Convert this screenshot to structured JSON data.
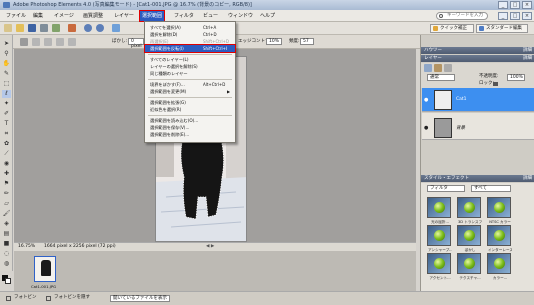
{
  "titlebar": {
    "title": "Adobe Photoshop Elements 4.0 (写真編集モード) - [Cat1-001.JPG @ 16.7% (背景のコピー, RGB/8)]"
  },
  "menubar": {
    "items": [
      "ファイル",
      "編集",
      "イメージ",
      "画質調整",
      "レイヤー",
      "選択範囲",
      "フィルタ",
      "ビュー",
      "ウィンドウ",
      "ヘルプ"
    ],
    "search_placeholder": "キーワードを入力"
  },
  "toolbar": {
    "quickfix_label": "クイック補正",
    "stdedit_label": "スタンダード編集"
  },
  "options": {
    "feather_label": "ぼかし:",
    "feather_value": "0 pixel",
    "edge_contrast_label": "エッジコントラスト:",
    "edge_contrast_value": "10%",
    "frequency_label": "頻度:",
    "frequency_value": "57"
  },
  "select_menu": {
    "items": [
      {
        "label": "すべてを選択(A)",
        "shortcut": "Ctrl+A"
      },
      {
        "label": "選択を解除(D)",
        "shortcut": "Ctrl+D"
      },
      {
        "label": "再選択(E)",
        "shortcut": "Shift+Ctrl+D"
      },
      {
        "label": "選択範囲を反転(I)",
        "shortcut": "Shift+Ctrl+I"
      },
      {
        "label": "すべてのレイヤー(L)",
        "shortcut": ""
      },
      {
        "label": "レイヤーの選択を解除(S)",
        "shortcut": ""
      },
      {
        "label": "同じ種類のレイヤー",
        "shortcut": ""
      },
      {
        "label": "境界をぼかす(F)...",
        "shortcut": "Alt+Ctrl+D"
      },
      {
        "label": "選択範囲を変更(M)",
        "shortcut": "▶"
      },
      {
        "label": "選択範囲を拡張(G)",
        "shortcut": ""
      },
      {
        "label": "近似色を選択(R)",
        "shortcut": ""
      },
      {
        "label": "選択範囲を読み込む(O)...",
        "shortcut": ""
      },
      {
        "label": "選択範囲を保存(V)...",
        "shortcut": ""
      },
      {
        "label": "選択範囲を削除(E)...",
        "shortcut": ""
      }
    ]
  },
  "status": {
    "zoom": "16.75%",
    "docinfo": "1664 pixel x 2256 pixel (72 ppi)"
  },
  "bin": {
    "thumb_label": "Cat1-001.JPG"
  },
  "bottom": {
    "bin_label": "フォトビン",
    "bin_option": "フォトビンを隠す",
    "bin_info": "開いているファイルを表示"
  },
  "panels": {
    "howto_title": "ハウツー",
    "layers_title": "レイヤー",
    "more": "詳細",
    "blend_mode": "通常",
    "opacity_label": "不透明度:",
    "opacity_value": "100%",
    "lock_label": "ロック:",
    "layer1_name": "Cat1",
    "layer2_name": "背景",
    "styles_title": "スタイル・エフェクト",
    "filter_label": "フィルタ",
    "filter_value": "すべて",
    "style_items": [
      "光の屈折...",
      "3D トランスフ...",
      "NTSC カラー",
      "アンシャープ...",
      "ぼかし",
      "インターレース...",
      "アクセント...",
      "テクスチャ...",
      "カラー..."
    ]
  },
  "colors": {
    "accent": "#2d5bbf",
    "highlight_outline": "#e00000",
    "layer_selected": "#3d8ff0"
  }
}
